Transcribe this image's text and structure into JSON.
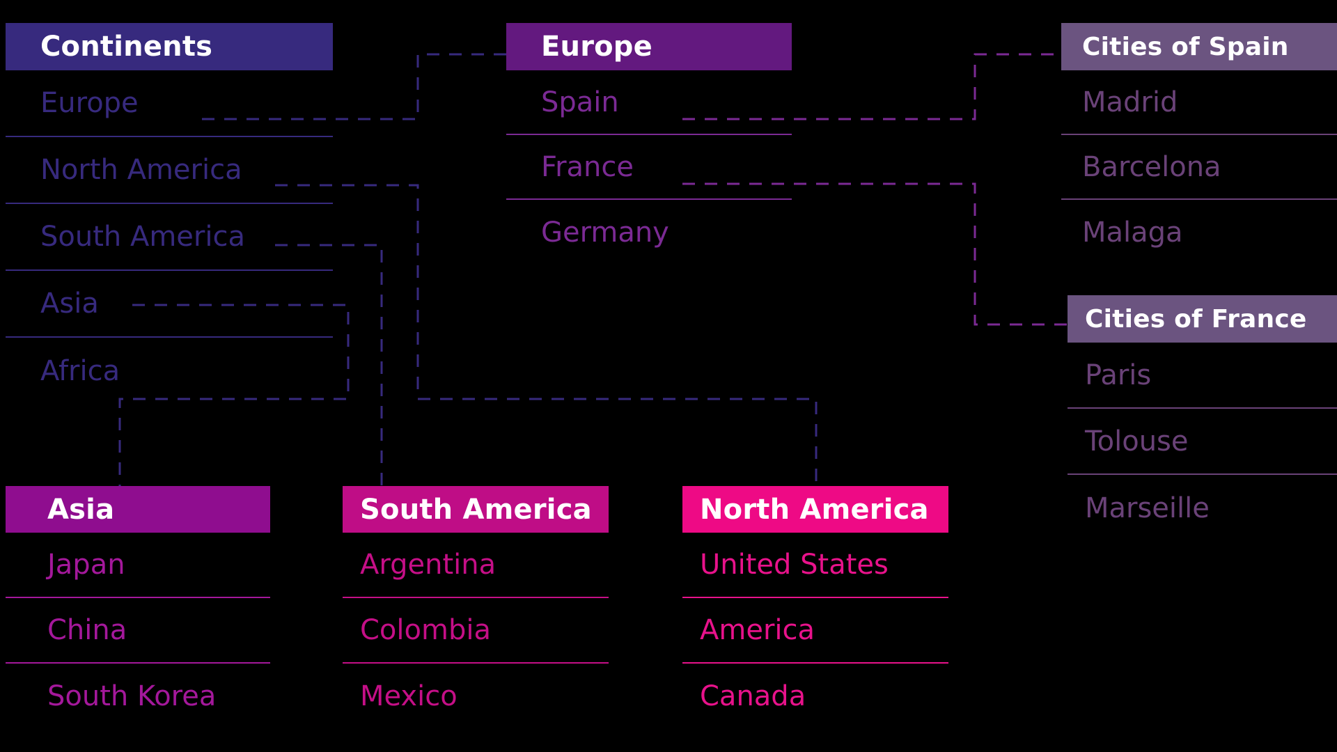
{
  "colors": {
    "background": "#000000",
    "continents_header": "#372A7E",
    "continents_text": "#372A7E",
    "europe_header": "#63197F",
    "europe_text": "#7B2A94",
    "cities_header": "#6B5480",
    "cities_text": "#6A4278",
    "asia_header": "#8F0D8F",
    "asia_text": "#A4189B",
    "south_america_header": "#BF0D86",
    "south_america_text": "#C50F87",
    "north_america_header": "#EE0A85",
    "north_america_text": "#E8128B",
    "connector_blue": "#372A7E",
    "connector_purple": "#7B2A94"
  },
  "panels": {
    "continents": {
      "title": "Continents",
      "items": [
        {
          "label": "Europe"
        },
        {
          "label": "North America"
        },
        {
          "label": "South America"
        },
        {
          "label": "Asia"
        },
        {
          "label": "Africa"
        }
      ]
    },
    "europe": {
      "title": "Europe",
      "items": [
        {
          "label": "Spain"
        },
        {
          "label": "France"
        },
        {
          "label": "Germany"
        }
      ]
    },
    "cities_of_spain": {
      "title": "Cities of Spain",
      "items": [
        {
          "label": "Madrid"
        },
        {
          "label": "Barcelona"
        },
        {
          "label": "Malaga"
        }
      ]
    },
    "cities_of_france": {
      "title": "Cities of France",
      "items": [
        {
          "label": "Paris"
        },
        {
          "label": "Tolouse"
        },
        {
          "label": "Marseille"
        }
      ]
    },
    "asia": {
      "title": "Asia",
      "items": [
        {
          "label": "Japan"
        },
        {
          "label": "China"
        },
        {
          "label": "South Korea"
        }
      ]
    },
    "south_america": {
      "title": "South America",
      "items": [
        {
          "label": "Argentina"
        },
        {
          "label": "Colombia"
        },
        {
          "label": "Mexico"
        }
      ]
    },
    "north_america": {
      "title": "North America",
      "items": [
        {
          "label": "United States"
        },
        {
          "label": "America"
        },
        {
          "label": "Canada"
        }
      ]
    }
  },
  "connectors": [
    {
      "name": "europe-to-europe-panel",
      "from": "Europe",
      "to": "Europe",
      "color": "#372A7E"
    },
    {
      "name": "north-america-to-panel",
      "from": "North America",
      "to": "North America",
      "color": "#372A7E"
    },
    {
      "name": "south-america-to-panel",
      "from": "South America",
      "to": "South America",
      "color": "#372A7E"
    },
    {
      "name": "asia-to-panel",
      "from": "Asia",
      "to": "Asia",
      "color": "#372A7E"
    },
    {
      "name": "spain-to-cities-of-spain",
      "from": "Spain",
      "to": "Cities of Spain",
      "color": "#7B2A94"
    },
    {
      "name": "france-to-cities-of-france",
      "from": "France",
      "to": "Cities of France",
      "color": "#7B2A94"
    }
  ]
}
